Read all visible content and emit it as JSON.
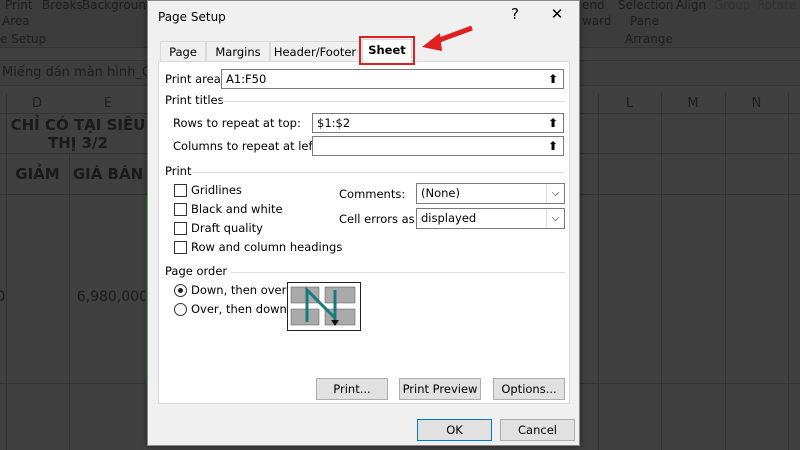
{
  "ribbon": {
    "print_area": "Print",
    "print_area2": "Area",
    "breaks": "Breaks",
    "background": "Background",
    "page_setup_group": "e Setup",
    "send_backward": "end",
    "send_backward2": "ward",
    "selection_pane": "Selection",
    "selection_pane2": "Pane",
    "align": "Align",
    "group": "Group",
    "rotate": "Rotate",
    "arrange_group": "Arrange"
  },
  "formula_bar": {
    "value": "Miếng dán màn hình_Chi"
  },
  "sheet": {
    "columns": [
      "D",
      "E",
      "L",
      "M",
      "N"
    ],
    "header_merged": "CHỈ CÓ TẠI SIÊU THỊ 3/2",
    "col_d": "GIẢM",
    "col_e": "GIÁ BÁN",
    "price": "6,980,000",
    "left_partial": "0"
  },
  "dialog": {
    "title": "Page Setup",
    "help": "?",
    "close": "✕",
    "tabs": [
      {
        "label": "Page"
      },
      {
        "label": "Margins"
      },
      {
        "label": "Header/Footer"
      },
      {
        "label": "Sheet",
        "active": true
      }
    ],
    "print_area": {
      "label": "Print area:",
      "value": "A1:F50"
    },
    "print_titles": {
      "heading": "Print titles",
      "rows_label": "Rows to repeat at top:",
      "rows_value": "$1:$2",
      "cols_label": "Columns to repeat at left:",
      "cols_value": ""
    },
    "print": {
      "heading": "Print",
      "gridlines": "Gridlines",
      "black_white": "Black and white",
      "draft": "Draft quality",
      "headings": "Row and column headings",
      "comments_label": "Comments:",
      "comments_value": "(None)",
      "errors_label": "Cell errors as:",
      "errors_value": "displayed"
    },
    "page_order": {
      "heading": "Page order",
      "down_over": "Down, then over",
      "over_down": "Over, then down",
      "selected": "Down, then over"
    },
    "buttons": {
      "print": "Print...",
      "preview": "Print Preview",
      "options": "Options...",
      "ok": "OK",
      "cancel": "Cancel"
    }
  },
  "annotation": {
    "highlight_color": "#e02020"
  }
}
